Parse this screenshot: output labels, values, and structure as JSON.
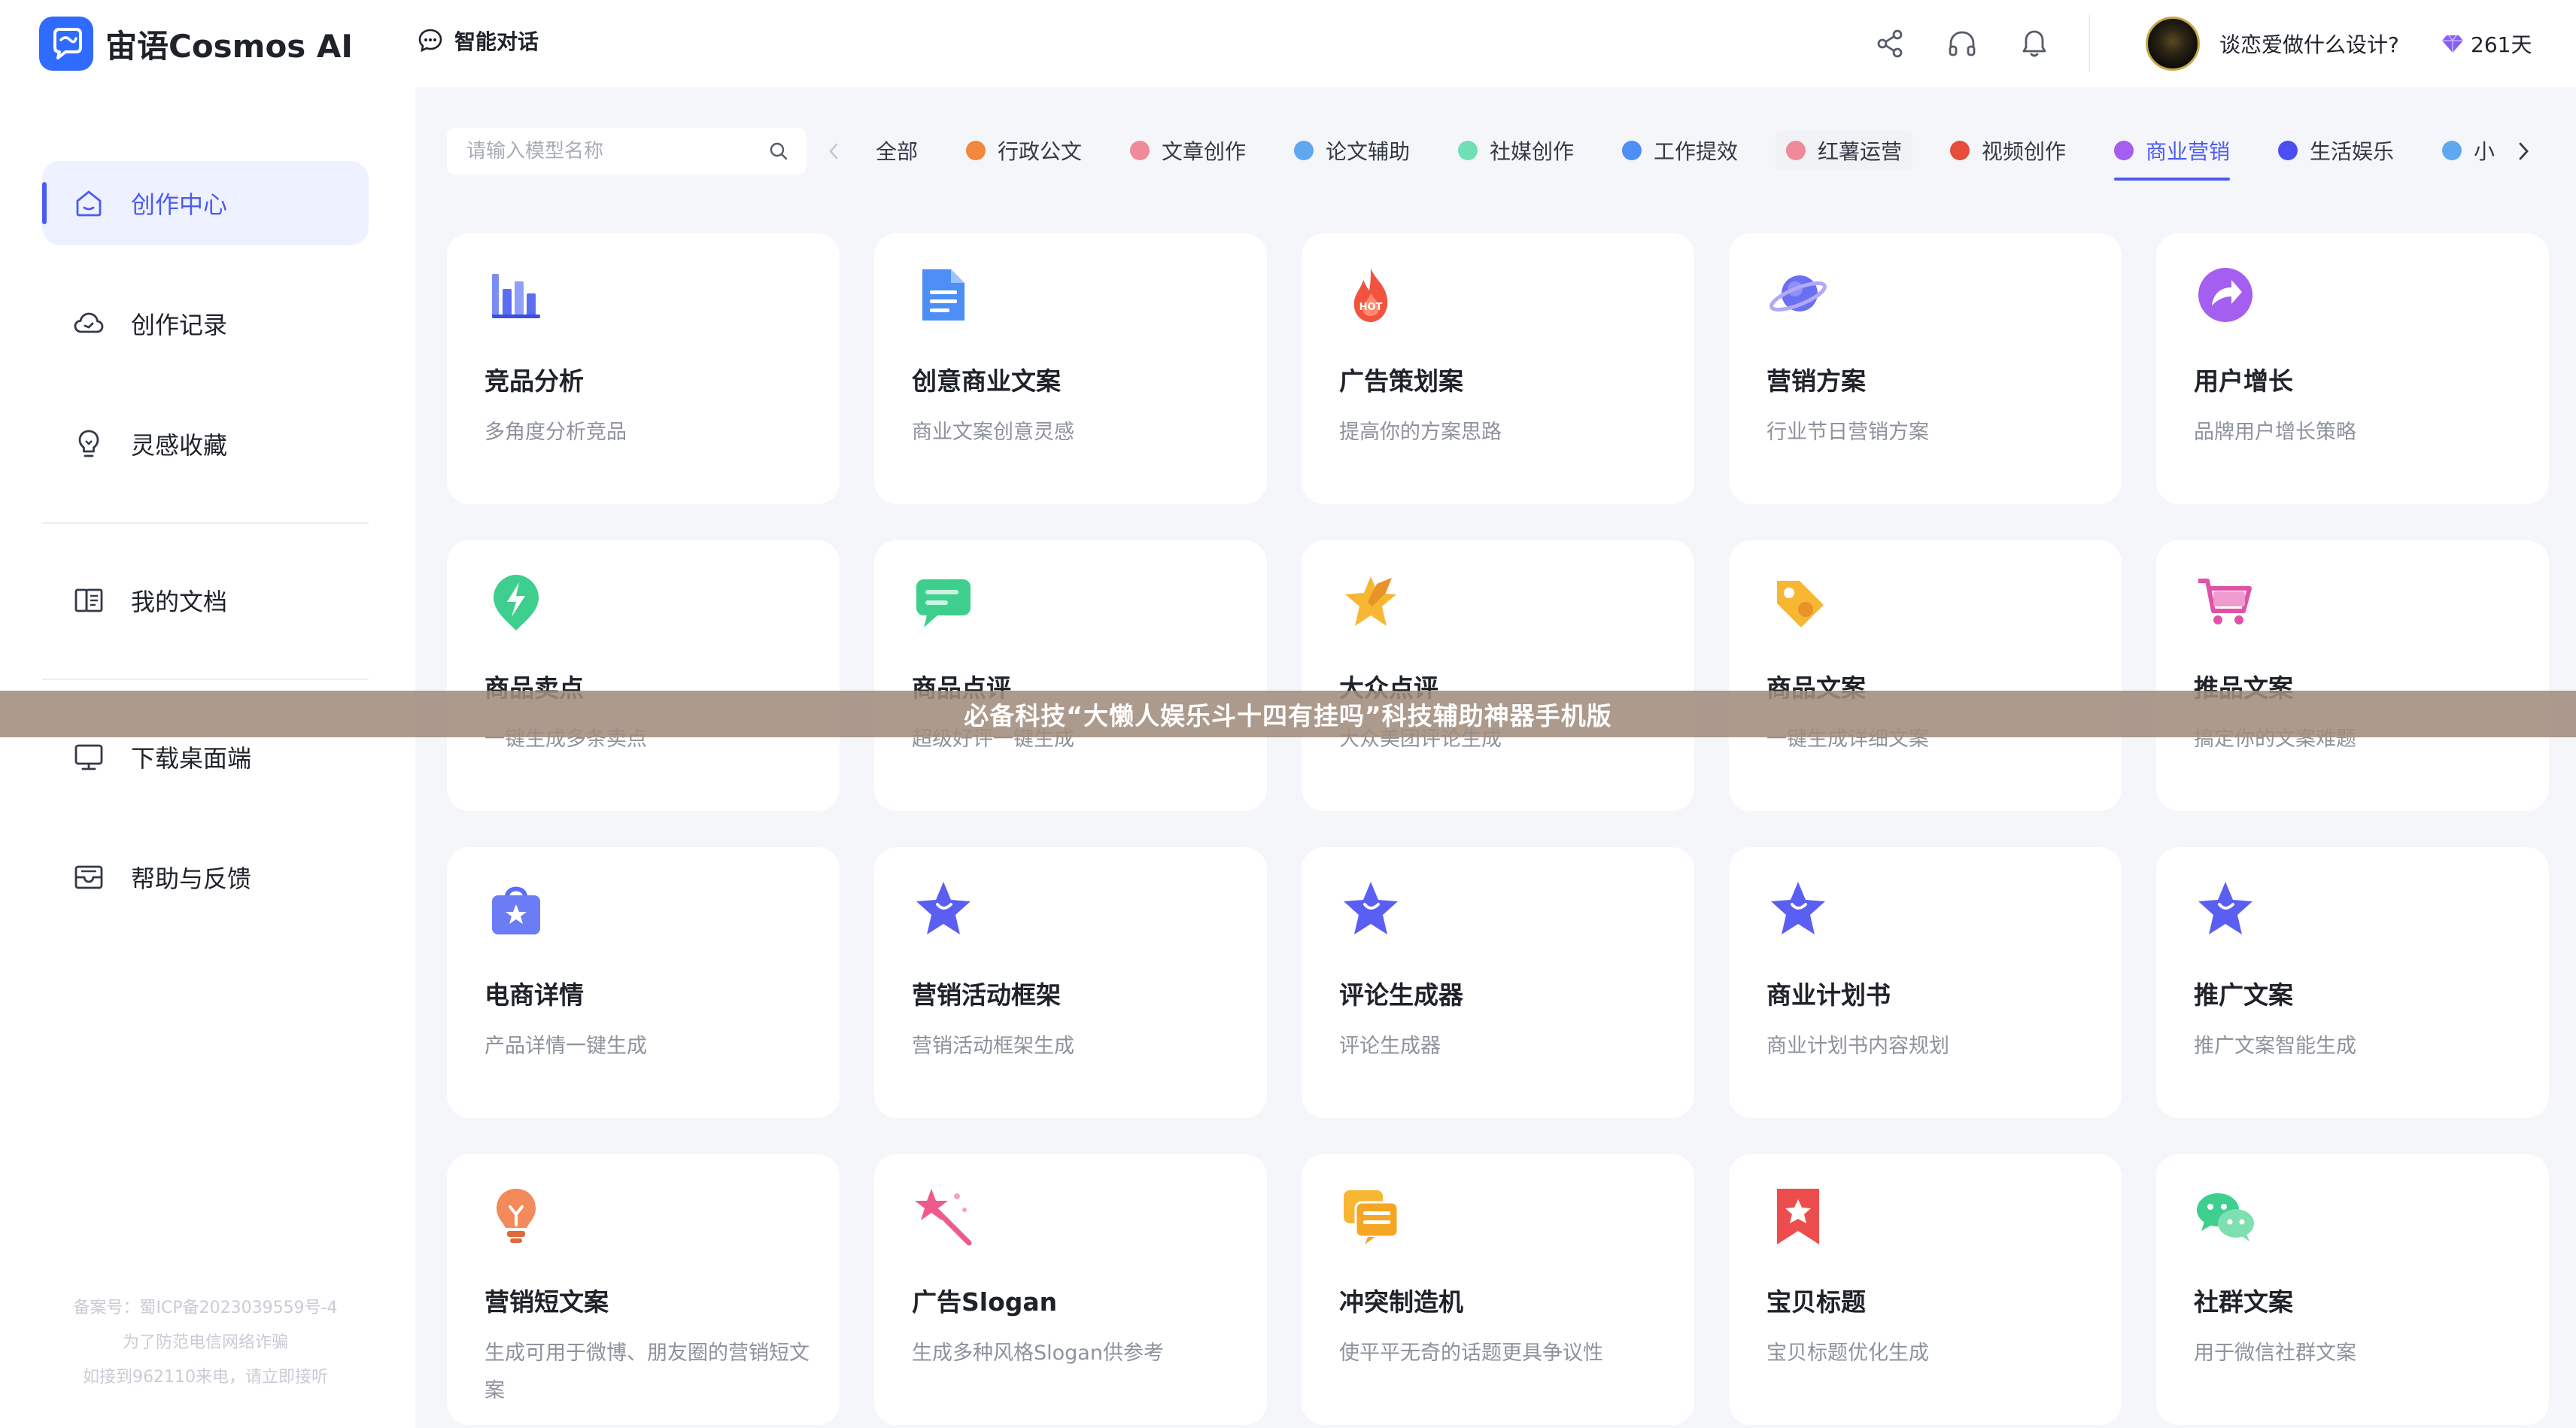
{
  "app": {
    "logo_text": "宙语Cosmos AI",
    "chat_nav_label": "智能对话"
  },
  "header": {
    "user_name": "谈恋爱做什么设计?",
    "credits": "261天"
  },
  "sidebar": {
    "items": [
      {
        "label": "创作中心",
        "icon": "home-icon"
      },
      {
        "label": "创作记录",
        "icon": "cloud-icon"
      },
      {
        "label": "灵感收藏",
        "icon": "lightbulb-icon"
      },
      {
        "label": "我的文档",
        "icon": "document-icon"
      },
      {
        "label": "下载桌面端",
        "icon": "monitor-icon"
      },
      {
        "label": "帮助与反馈",
        "icon": "mail-icon"
      }
    ],
    "footer_lines": [
      "备案号：蜀ICP备2023039559号-4",
      "为了防范电信网络诈骗",
      "如接到962110来电，请立即接听"
    ]
  },
  "search": {
    "placeholder": "请输入模型名称"
  },
  "tabs": [
    {
      "label": "全部",
      "color": ""
    },
    {
      "label": "行政公文",
      "color": "#f0883e"
    },
    {
      "label": "文章创作",
      "color": "#ee8a9a"
    },
    {
      "label": "论文辅助",
      "color": "#5fa8f0"
    },
    {
      "label": "社媒创作",
      "color": "#6fe0b4"
    },
    {
      "label": "工作提效",
      "color": "#4d8ef7"
    },
    {
      "label": "红薯运营",
      "color": "#ee8a9a"
    },
    {
      "label": "视频创作",
      "color": "#e74c3c"
    },
    {
      "label": "商业营销",
      "color": "#a45ef0"
    },
    {
      "label": "生活娱乐",
      "color": "#4b4ef0"
    },
    {
      "label": "小i",
      "color": "#5fa8f0"
    }
  ],
  "cards": [
    {
      "title": "竞品分析",
      "desc": "多角度分析竞品",
      "icon": "bar-chart-icon"
    },
    {
      "title": "创意商业文案",
      "desc": "商业文案创意灵感",
      "icon": "document-icon"
    },
    {
      "title": "广告策划案",
      "desc": "提高你的方案思路",
      "icon": "hot-flame-icon",
      "badge": "HOT"
    },
    {
      "title": "营销方案",
      "desc": "行业节日营销方案",
      "icon": "planet-icon"
    },
    {
      "title": "用户增长",
      "desc": "品牌用户增长策略",
      "icon": "share-arrow-icon"
    },
    {
      "title": "商品卖点",
      "desc": "一键生成多条卖点",
      "icon": "lightning-icon"
    },
    {
      "title": "商品点评",
      "desc": "超级好评一键生成",
      "icon": "chat-bubble-icon"
    },
    {
      "title": "大众点评",
      "desc": "大众美团评论生成",
      "icon": "star-pen-icon"
    },
    {
      "title": "商品文案",
      "desc": "一键生成详细文案",
      "icon": "tag-icon"
    },
    {
      "title": "推品文案",
      "desc": "搞定你的文案难题",
      "icon": "cart-icon"
    },
    {
      "title": "电商详情",
      "desc": "产品详情一键生成",
      "icon": "shopping-bag-icon"
    },
    {
      "title": "营销活动框架",
      "desc": "营销活动框架生成",
      "icon": "star-icon"
    },
    {
      "title": "评论生成器",
      "desc": "评论生成器",
      "icon": "star-icon"
    },
    {
      "title": "商业计划书",
      "desc": "商业计划书内容规划",
      "icon": "star-icon"
    },
    {
      "title": "推广文案",
      "desc": "推广文案智能生成",
      "icon": "star-icon"
    },
    {
      "title": "营销短文案",
      "desc": "生成可用于微博、朋友圈的营销短文案",
      "icon": "lightbulb-icon"
    },
    {
      "title": "广告Slogan",
      "desc": "生成多种风格Slogan供参考",
      "icon": "magic-wand-icon"
    },
    {
      "title": "冲突制造机",
      "desc": "使平平无奇的话题更具争议性",
      "icon": "message-box-icon"
    },
    {
      "title": "宝贝标题",
      "desc": "宝贝标题优化生成",
      "icon": "bookmark-star-icon"
    },
    {
      "title": "社群文案",
      "desc": "用于微信社群文案",
      "icon": "wechat-icon"
    }
  ],
  "banner": {
    "text": "必备科技“大懒人娱乐斗十四有挂吗”科技辅助神器手机版"
  },
  "colors": {
    "accent": "#4b5cf0",
    "logo_blue": "#2f6bff"
  }
}
